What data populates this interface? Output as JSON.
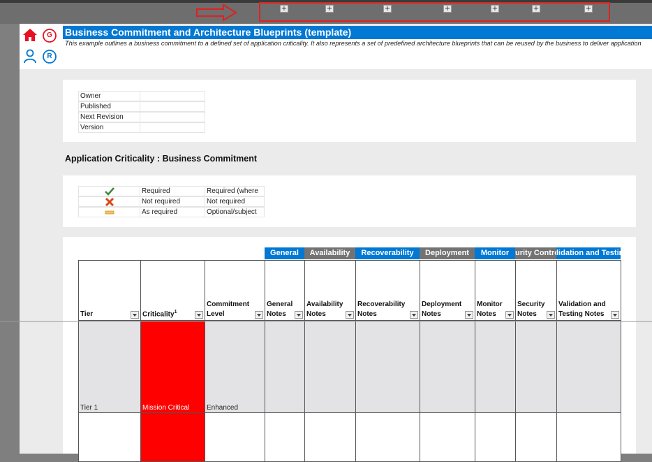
{
  "page_title": "Business Commitment and Architecture Blueprints (template)",
  "description": "This example outlines a business commitment to a defined set of application criticality. It also represents a set of predefined architecture blueprints that can be reused by the business to deliver application",
  "expand_button_label": "+",
  "nav_icons": [
    {
      "name": "home-icon",
      "label": ""
    },
    {
      "name": "governance-icon",
      "label": "G"
    },
    {
      "name": "user-icon",
      "label": ""
    },
    {
      "name": "resources-icon",
      "label": "R"
    }
  ],
  "metadata": {
    "rows": [
      {
        "label": "Owner",
        "value": ""
      },
      {
        "label": "Published",
        "value": ""
      },
      {
        "label": "Next Revision",
        "value": ""
      },
      {
        "label": "Version",
        "value": ""
      }
    ]
  },
  "section_title": "Application Criticality : Business Commitment",
  "legend": {
    "rows": [
      {
        "icon": "checkmark-icon",
        "status": "Required",
        "note": "Required (where"
      },
      {
        "icon": "cross-icon",
        "status": "Not required",
        "note": "Not required"
      },
      {
        "icon": "dash-icon",
        "status": "As required",
        "note": "Optional/subject"
      }
    ]
  },
  "table": {
    "groups": [
      {
        "label": "General"
      },
      {
        "label": "Availability"
      },
      {
        "label": "Recoverability"
      },
      {
        "label": "Deployment"
      },
      {
        "label": "Monitor"
      },
      {
        "label": "urity Contro"
      },
      {
        "label": "lidation and Testin"
      }
    ],
    "columns": [
      {
        "line1": "",
        "line2": "Tier"
      },
      {
        "line1": "",
        "line2": "Criticality",
        "sup": "1"
      },
      {
        "line1": "Commitment",
        "line2": "Level"
      },
      {
        "line1": "General",
        "line2": "Notes"
      },
      {
        "line1": "Availability",
        "line2": "Notes"
      },
      {
        "line1": "Recoverability",
        "line2": "Notes"
      },
      {
        "line1": "Deployment",
        "line2": "Notes"
      },
      {
        "line1": "Monitor",
        "line2": "Notes"
      },
      {
        "line1": "Security",
        "line2": "Notes"
      },
      {
        "line1": "Validation and",
        "line2": "Testing Notes"
      }
    ],
    "rows": [
      {
        "tier": "Tier 1",
        "criticality": "Mission Critical",
        "commitment": "Enhanced"
      },
      {
        "tier": "",
        "criticality": "",
        "commitment": ""
      }
    ]
  },
  "colors": {
    "accent_blue": "#0078d4",
    "group_gray": "#737373",
    "critical_red": "#ff0000",
    "annotation_red": "#e02020"
  }
}
